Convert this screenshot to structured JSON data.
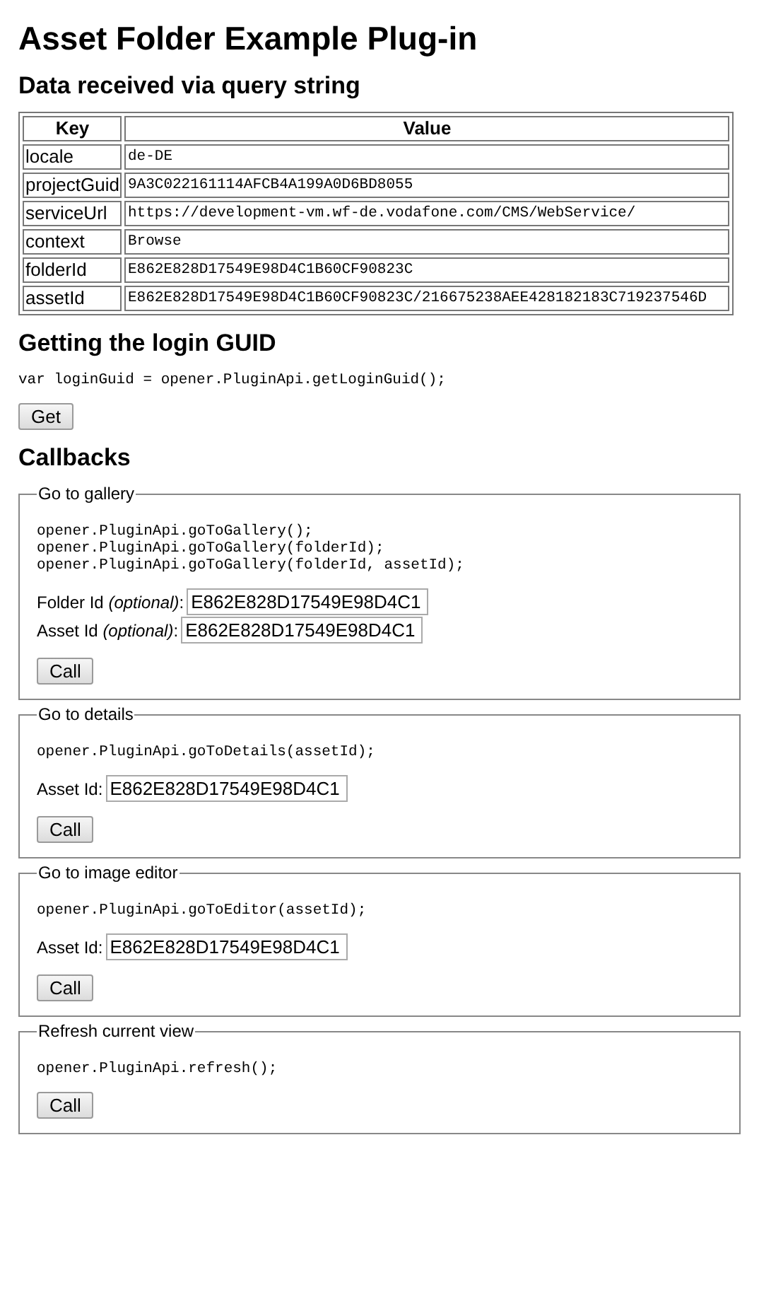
{
  "title": "Asset Folder Example Plug-in",
  "query_section": {
    "heading": "Data received via query string",
    "table": {
      "columns": [
        "Key",
        "Value"
      ],
      "rows": [
        [
          "locale",
          "de-DE"
        ],
        [
          "projectGuid",
          "9A3C022161114AFCB4A199A0D6BD8055"
        ],
        [
          "serviceUrl",
          "https://development-vm.wf-de.vodafone.com/CMS/WebService/"
        ],
        [
          "context",
          "Browse"
        ],
        [
          "folderId",
          "E862E828D17549E98D4C1B60CF90823C"
        ],
        [
          "assetId",
          "E862E828D17549E98D4C1B60CF90823C/216675238AEE428182183C719237546D"
        ]
      ]
    }
  },
  "login_section": {
    "heading": "Getting the login GUID",
    "code": [
      "var loginGuid = opener.PluginApi.getLoginGuid();"
    ],
    "button": "Get"
  },
  "callbacks": {
    "heading": "Callbacks",
    "groups": [
      {
        "legend": "Go to gallery",
        "code": [
          "opener.PluginApi.goToGallery();",
          "opener.PluginApi.goToGallery(folderId);",
          "opener.PluginApi.goToGallery(folderId, assetId);"
        ],
        "fields": [
          {
            "label": "Folder Id *(optional)*:",
            "value": "E862E828D17549E98D4C1"
          },
          {
            "label": "Asset Id *(optional)*:",
            "value": "E862E828D17549E98D4C1"
          }
        ],
        "button": "Call"
      },
      {
        "legend": "Go to details",
        "code": [
          "opener.PluginApi.goToDetails(assetId);"
        ],
        "fields": [
          {
            "label": "Asset Id:",
            "value": "E862E828D17549E98D4C1"
          }
        ],
        "button": "Call"
      },
      {
        "legend": "Go to image editor",
        "code": [
          "opener.PluginApi.goToEditor(assetId);"
        ],
        "fields": [
          {
            "label": "Asset Id:",
            "value": "E862E828D17549E98D4C1"
          }
        ],
        "button": "Call"
      },
      {
        "legend": "Refresh current view",
        "code": [
          "opener.PluginApi.refresh();"
        ],
        "button": "Call"
      }
    ]
  }
}
